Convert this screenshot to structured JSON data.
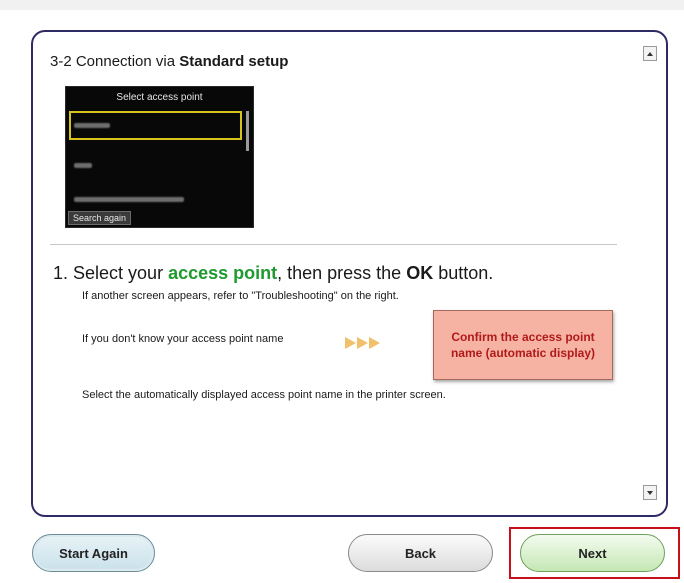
{
  "dialog": {
    "step_prefix": "3-2 Connection via ",
    "step_bold": "Standard setup"
  },
  "printer_screen": {
    "title": "Select access point",
    "search_again": "Search again"
  },
  "instruction": {
    "number": "1. ",
    "pre": "Select your ",
    "highlight": "access point",
    "mid": ", then press the ",
    "ok": "OK",
    "post": " button.",
    "sub": "If another screen appears, refer to \"Troubleshooting\" on the right.",
    "hint": "If you don't know your access point name",
    "confirm_button": "Confirm the access point name (automatic display)",
    "select_note": "Select the automatically displayed access point name in the printer screen."
  },
  "buttons": {
    "start_again": "Start Again",
    "back": "Back",
    "next": "Next"
  },
  "colors": {
    "panel_border": "#2e2a63",
    "highlight_green": "#1e9a2e",
    "confirm_bg": "#f6b3a3",
    "confirm_text": "#b01a1a",
    "next_focus": "#c8101a"
  }
}
